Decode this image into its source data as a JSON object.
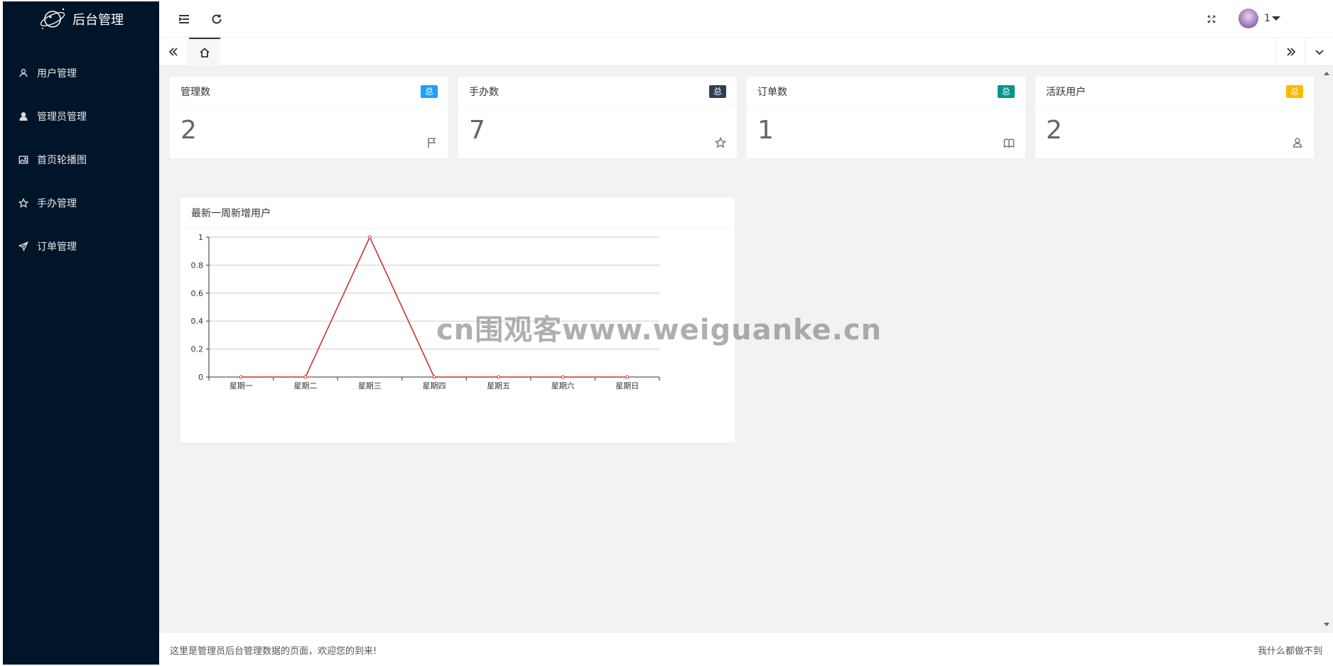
{
  "app": {
    "title": "后台管理"
  },
  "sidebar": {
    "items": [
      {
        "label": "用户管理",
        "icon": "user-outline-icon"
      },
      {
        "label": "管理员管理",
        "icon": "user-filled-icon"
      },
      {
        "label": "首页轮播图",
        "icon": "image-icon"
      },
      {
        "label": "手办管理",
        "icon": "star-icon"
      },
      {
        "label": "订单管理",
        "icon": "send-icon"
      }
    ]
  },
  "header": {
    "user_name": "1"
  },
  "cards": [
    {
      "title": "管理数",
      "badge": "总",
      "badge_color": "#1E9FFF",
      "value": "2",
      "icon": "flag-icon"
    },
    {
      "title": "手办数",
      "badge": "总",
      "badge_color": "#2F4056",
      "value": "7",
      "icon": "star-icon"
    },
    {
      "title": "订单数",
      "badge": "总",
      "badge_color": "#009688",
      "value": "1",
      "icon": "book-icon"
    },
    {
      "title": "活跃用户",
      "badge": "总",
      "badge_color": "#FFB800",
      "value": "2",
      "icon": "user-icon"
    }
  ],
  "chart_title": "最新一周新增用户",
  "chart_data": {
    "type": "line",
    "title": "最新一周新增用户",
    "categories": [
      "星期一",
      "星期二",
      "星期三",
      "星期四",
      "星期五",
      "星期六",
      "星期日"
    ],
    "series": [
      {
        "values": [
          0,
          0,
          1,
          0,
          0,
          0,
          0
        ]
      }
    ],
    "yticks": [
      "0",
      "0.2",
      "0.4",
      "0.6",
      "0.8",
      "1"
    ],
    "ylim": [
      0,
      1
    ],
    "grid": true,
    "line_color": "#c23531"
  },
  "watermark": "cn围观客www.weiguanke.cn",
  "footer": {
    "left": "这里是管理员后台管理数据的页面，欢迎您的到来!",
    "right": "我什么都做不到"
  }
}
